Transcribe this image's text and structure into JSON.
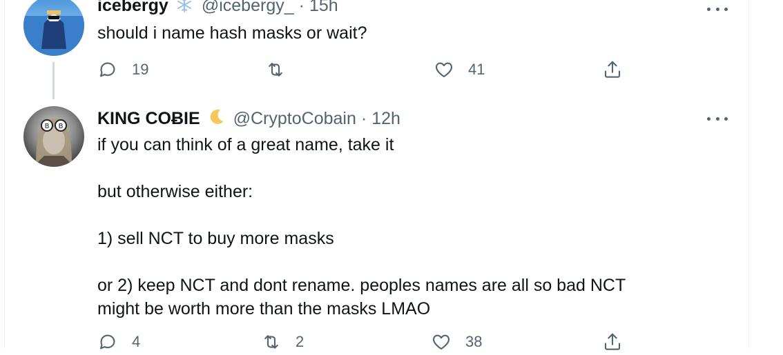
{
  "tweets": [
    {
      "name": "icebergy",
      "badge_icon": "snowflake-icon",
      "handle": "@icebergy_",
      "time": "15h",
      "text": [
        "should i name hash masks or wait?"
      ],
      "replies": "19",
      "retweets": "",
      "likes": "41"
    },
    {
      "name": "KING COɃIE",
      "badge_icon": "crescent-moon-icon",
      "handle": "@CryptoCobain",
      "time": "12h",
      "text": [
        "if you can think of a great name, take it",
        "",
        "but otherwise either:",
        "",
        "1) sell NCT to buy more masks",
        "",
        "or 2) keep NCT and dont rename. peoples names are all so bad NCT",
        "might be worth more than the masks LMAO"
      ],
      "replies": "4",
      "retweets": "2",
      "likes": "38"
    }
  ],
  "separator": "·",
  "colors": {
    "text": "#0f1419",
    "muted": "#536471",
    "border": "#eff3f4",
    "thread_line": "#cfd9de"
  }
}
